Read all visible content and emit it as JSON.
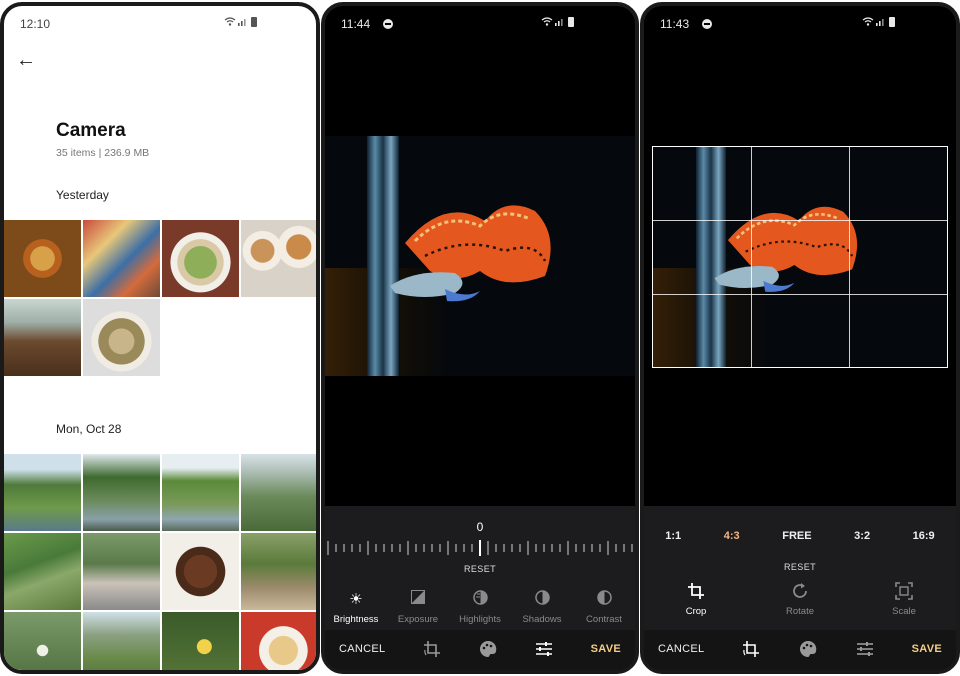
{
  "gallery": {
    "status_time": "12:10",
    "title": "Camera",
    "subtitle": "35 items | 236.9 MB",
    "sections": [
      {
        "label": "Yesterday",
        "photos": [
          "pizza",
          "market stall",
          "pho bowl",
          "coffee cups",
          "restaurant tables",
          "noodle soup"
        ]
      },
      {
        "label": "Mon, Oct 28",
        "photos": [
          "river valley",
          "river bank",
          "rock island",
          "mountain road",
          "rice terraces",
          "family portrait",
          "grilled meat",
          "hiker with basket",
          "flowers",
          "valley view",
          "yellow flower",
          "spring rolls"
        ]
      }
    ]
  },
  "adjust_editor": {
    "status_time": "11:44",
    "slider_value": "0",
    "reset_label": "RESET",
    "tools": [
      {
        "label": "Brightness",
        "icon": "sun-icon",
        "active": true
      },
      {
        "label": "Exposure",
        "icon": "exposure-icon",
        "active": false
      },
      {
        "label": "Highlights",
        "icon": "highlights-icon",
        "active": false
      },
      {
        "label": "Shadows",
        "icon": "shadows-icon",
        "active": false
      },
      {
        "label": "Contrast",
        "icon": "contrast-icon",
        "active": false
      }
    ],
    "cancel_label": "CANCEL",
    "save_label": "SAVE",
    "active_tab": "adjust"
  },
  "crop_editor": {
    "status_time": "11:43",
    "ratios": [
      "1:1",
      "4:3",
      "FREE",
      "3:2",
      "16:9"
    ],
    "selected_ratio": "4:3",
    "reset_label": "RESET",
    "tools": [
      {
        "label": "Crop",
        "icon": "crop-icon",
        "active": true
      },
      {
        "label": "Rotate",
        "icon": "rotate-icon",
        "active": false
      },
      {
        "label": "Scale",
        "icon": "scale-icon",
        "active": false
      }
    ],
    "cancel_label": "CANCEL",
    "save_label": "SAVE",
    "active_tab": "crop"
  },
  "colors": {
    "accent_save": "#f4cf84",
    "selected_ratio": "#f4b583",
    "panel_bg": "#1c1c1e"
  }
}
